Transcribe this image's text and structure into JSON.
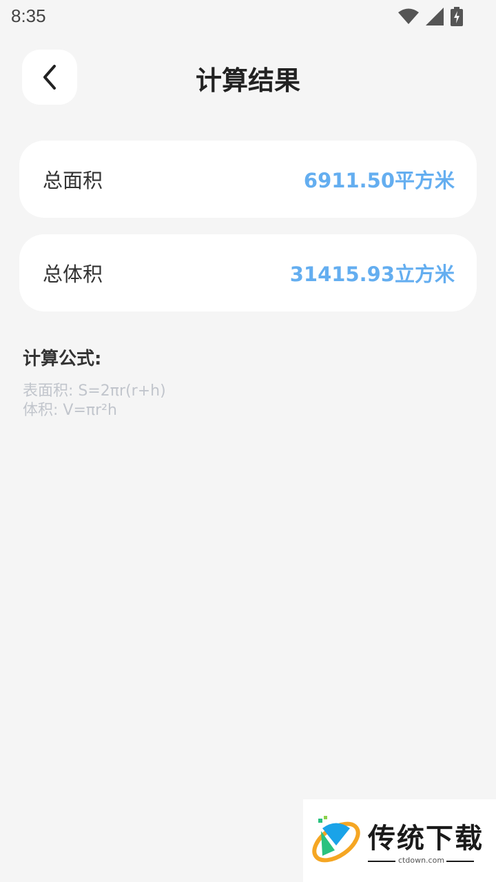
{
  "status_bar": {
    "time": "8:35",
    "icons": [
      "wifi-icon",
      "signal-icon",
      "battery-charging-icon"
    ]
  },
  "header": {
    "back_icon": "chevron-left-icon",
    "title": "计算结果"
  },
  "results": {
    "area_label": "总面积",
    "area_value": "6911.50平方米",
    "volume_label": "总体积",
    "volume_value": "31415.93立方米"
  },
  "formula": {
    "title": "计算公式:",
    "surface": "表面积: S=2πr(r+h)",
    "volume": "体积: V=πr²h"
  },
  "watermark": {
    "brand": "传统下载",
    "domain": "ctdown.com"
  },
  "colors": {
    "accent": "#64aef0",
    "background": "#f5f5f5",
    "card": "#ffffff",
    "muted_text": "#c1c5cc"
  }
}
